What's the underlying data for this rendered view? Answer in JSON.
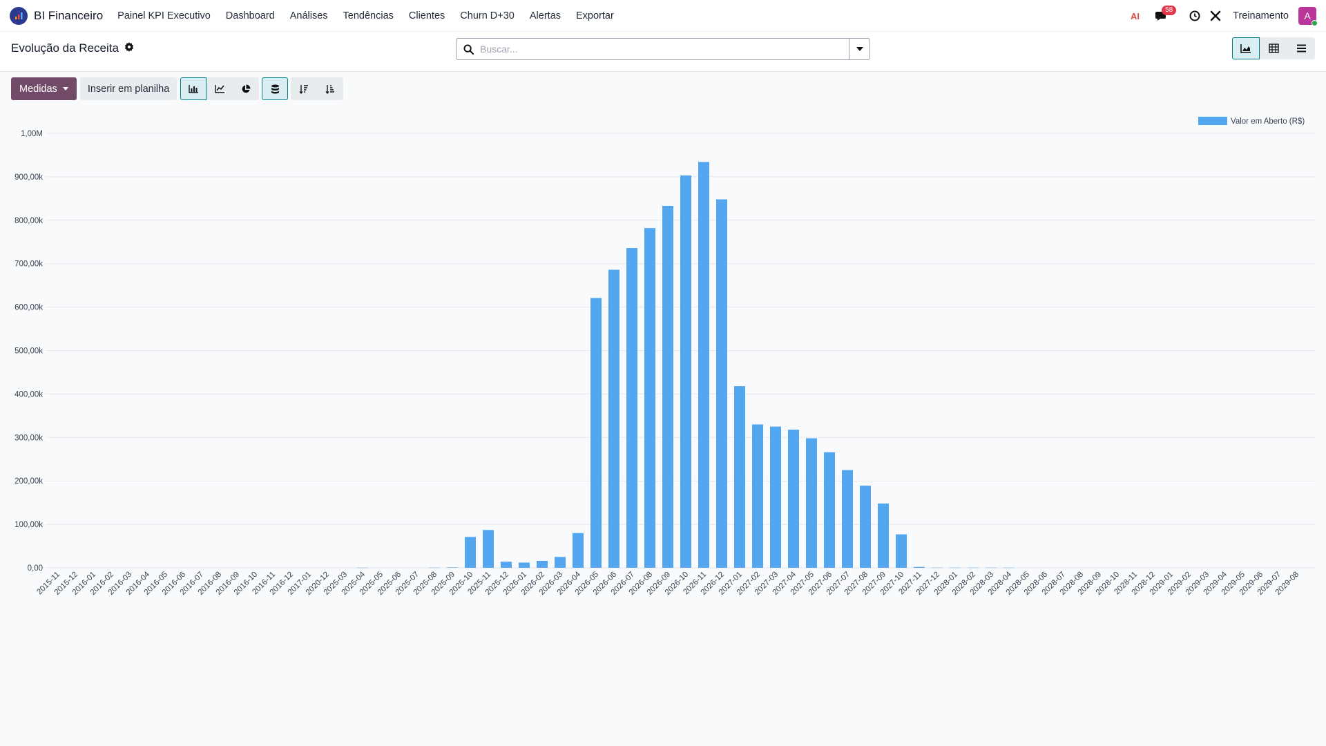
{
  "navbar": {
    "brand": "BI Financeiro",
    "menu": [
      "Painel KPI Executivo",
      "Dashboard",
      "Análises",
      "Tendências",
      "Clientes",
      "Churn D+30",
      "Alertas",
      "Exportar"
    ],
    "ai_label": "AI",
    "messages_count": "58",
    "user_name": "Treinamento",
    "avatar_letter": "A"
  },
  "control_panel": {
    "title": "Evolução da Receita",
    "search_placeholder": "Buscar..."
  },
  "toolbar": {
    "measures_label": "Medidas",
    "insert_label": "Inserir em planilha"
  },
  "colors": {
    "bar": "#53a6f0",
    "accent": "#714b67",
    "active_border": "#017e84"
  },
  "chart_data": {
    "type": "bar",
    "ylim": [
      0,
      1000000
    ],
    "yticks": [
      "0,00",
      "100,00k",
      "200,00k",
      "300,00k",
      "400,00k",
      "500,00k",
      "600,00k",
      "700,00k",
      "800,00k",
      "900,00k",
      "1,00M"
    ],
    "series": [
      {
        "name": "Valor em Aberto (R$)"
      }
    ],
    "categories": [
      "2015-11",
      "2015-12",
      "2016-01",
      "2016-02",
      "2016-03",
      "2016-04",
      "2016-05",
      "2016-06",
      "2016-07",
      "2016-08",
      "2016-09",
      "2016-10",
      "2016-11",
      "2016-12",
      "2017-01",
      "2020-12",
      "2025-03",
      "2025-04",
      "2025-05",
      "2025-06",
      "2025-07",
      "2025-08",
      "2025-09",
      "2025-10",
      "2025-11",
      "2025-12",
      "2026-01",
      "2026-02",
      "2026-03",
      "2026-04",
      "2026-05",
      "2026-06",
      "2026-07",
      "2026-08",
      "2026-09",
      "2026-10",
      "2026-11",
      "2026-12",
      "2027-01",
      "2027-02",
      "2027-03",
      "2027-04",
      "2027-05",
      "2027-06",
      "2027-07",
      "2027-08",
      "2027-09",
      "2027-10",
      "2027-11",
      "2027-12",
      "2028-01",
      "2028-02",
      "2028-03",
      "2028-04",
      "2028-05",
      "2028-06",
      "2028-07",
      "2028-08",
      "2028-09",
      "2028-10",
      "2028-11",
      "2028-12",
      "2029-01",
      "2029-02",
      "2029-03",
      "2029-04",
      "2029-05",
      "2029-06",
      "2029-07",
      "2029-08"
    ],
    "values": [
      0,
      0,
      0,
      0,
      0,
      0,
      0,
      0,
      0,
      0,
      0,
      0,
      0,
      0,
      0,
      0,
      0,
      200,
      0,
      0,
      0,
      500,
      1000,
      71000,
      87000,
      14000,
      12000,
      16000,
      25000,
      80000,
      621000,
      686000,
      736000,
      782000,
      833000,
      903000,
      934000,
      848000,
      418000,
      330000,
      325000,
      318000,
      298000,
      266000,
      225000,
      189000,
      148000,
      77000,
      2000,
      500,
      500,
      500,
      500,
      300,
      0,
      0,
      0,
      0,
      0,
      0,
      0,
      0,
      0,
      0,
      0,
      0,
      0,
      0,
      0,
      0
    ]
  }
}
